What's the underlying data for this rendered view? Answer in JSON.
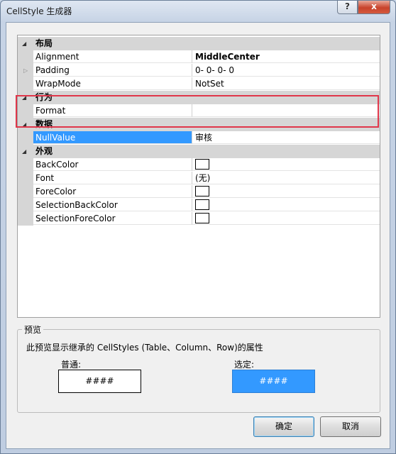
{
  "window": {
    "title": "CellStyle 生成器",
    "help_label": "?",
    "close_label": "x"
  },
  "grid": {
    "categories": {
      "layout": "布局",
      "behavior": "行为",
      "data": "数据",
      "appearance": "外观"
    },
    "properties": {
      "alignment": {
        "name": "Alignment",
        "value": "MiddleCenter"
      },
      "padding": {
        "name": "Padding",
        "value": "0- 0- 0- 0"
      },
      "wrapmode": {
        "name": "WrapMode",
        "value": "NotSet"
      },
      "format": {
        "name": "Format",
        "value": ""
      },
      "nullvalue": {
        "name": "NullValue",
        "value": "审核"
      },
      "backcolor": {
        "name": "BackColor",
        "value": ""
      },
      "font": {
        "name": "Font",
        "value": "(无)"
      },
      "forecolor": {
        "name": "ForeColor",
        "value": ""
      },
      "selectionbackcolor": {
        "name": "SelectionBackColor",
        "value": ""
      },
      "selectionforecolor": {
        "name": "SelectionForeColor",
        "value": ""
      }
    },
    "selected_property": "NullValue",
    "selection_color": "#3399ff"
  },
  "preview": {
    "legend": "预览",
    "description": "此预览显示继承的 CellStyles (Table、Column、Row)的属性",
    "normal_label": "普通:",
    "selected_label": "选定:",
    "normal_sample": "####",
    "selected_sample": "####",
    "selected_color": "#3399ff"
  },
  "buttons": {
    "ok": "确定",
    "cancel": "取消"
  },
  "annotation_color": "#e0364a"
}
